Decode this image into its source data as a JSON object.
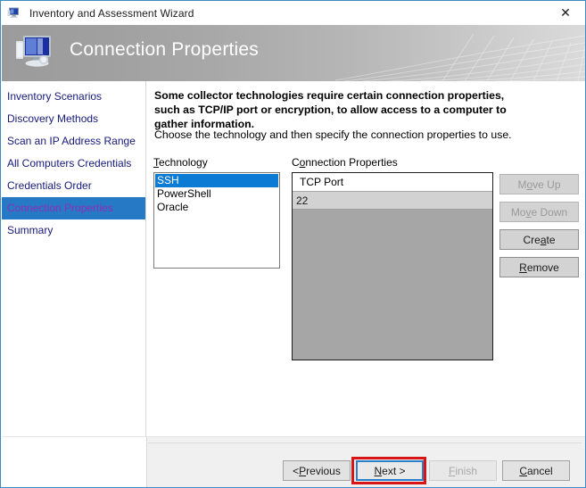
{
  "window": {
    "title": "Inventory and Assessment Wizard",
    "title_icon": "computer-icon",
    "close_icon": "✕",
    "border_color": "#3f8cc4"
  },
  "header": {
    "title": "Connection Properties",
    "icon": "computer-monitor-icon"
  },
  "sidebar": {
    "items": [
      {
        "label": "Inventory Scenarios",
        "selected": false
      },
      {
        "label": "Discovery Methods",
        "selected": false
      },
      {
        "label": "Scan an IP Address Range",
        "selected": false
      },
      {
        "label": "All Computers Credentials",
        "selected": false
      },
      {
        "label": "Credentials Order",
        "selected": false
      },
      {
        "label": "Connection Properties",
        "selected": true
      },
      {
        "label": "Summary",
        "selected": false
      }
    ],
    "link_color": "#16197a",
    "selected_color": "#2679c4"
  },
  "main": {
    "intro_bold": "Some collector technologies require certain connection properties, such as TCP/IP port or encryption, to allow access to a computer to gather information.",
    "intro_normal": "Choose the technology and then specify the connection properties to use.",
    "technology": {
      "label_prefix": "",
      "label_accel": "T",
      "label_suffix": "echnology",
      "items": [
        {
          "label": "SSH",
          "selected": true
        },
        {
          "label": "PowerShell",
          "selected": false
        },
        {
          "label": "Oracle",
          "selected": false
        }
      ]
    },
    "connection_properties": {
      "label_prefix": "C",
      "label_accel": "o",
      "label_suffix": "nnection Properties",
      "columns": [
        "TCP Port"
      ],
      "rows": [
        [
          "22"
        ]
      ]
    },
    "side_buttons": [
      {
        "prefix": "M",
        "accel": "o",
        "suffix": "ve Up",
        "enabled": false
      },
      {
        "prefix": "Mo",
        "accel": "v",
        "suffix": "e Down",
        "enabled": false
      },
      {
        "prefix": "Cre",
        "accel": "a",
        "suffix": "te",
        "enabled": true
      },
      {
        "prefix": "",
        "accel": "R",
        "suffix": "emove",
        "enabled": true
      }
    ]
  },
  "footer": {
    "buttons": [
      {
        "prefix": "< ",
        "accel": "P",
        "suffix": "revious",
        "enabled": true,
        "focused": false
      },
      {
        "prefix": "",
        "accel": "N",
        "suffix": "ext >",
        "enabled": true,
        "focused": true
      },
      {
        "prefix": "",
        "accel": "F",
        "suffix": "inish",
        "enabled": false,
        "focused": false
      },
      {
        "prefix": "",
        "accel": "C",
        "suffix": "ancel",
        "enabled": true,
        "focused": false
      }
    ]
  },
  "annotation": {
    "target": "next-button",
    "color": "#d81515"
  }
}
